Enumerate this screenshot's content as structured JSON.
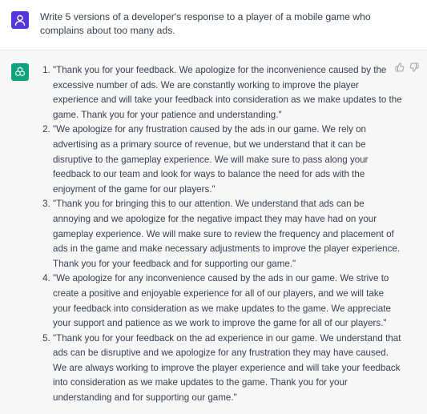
{
  "user": {
    "avatar_icon": "user-icon",
    "prompt": "Write 5 versions of a developer's response to a player of a mobile game who complains about too many ads."
  },
  "assistant": {
    "avatar_icon": "openai-logo-icon",
    "colors": {
      "user_avatar": "#5436da",
      "bot_avatar": "#10a37f"
    },
    "responses": [
      "\"Thank you for your feedback. We apologize for the inconvenience caused by the excessive number of ads. We are constantly working to improve the player experience and will take your feedback into consideration as we make updates to the game. Thank you for your patience and understanding.\"",
      "\"We apologize for any frustration caused by the ads in our game. We rely on advertising as a primary source of revenue, but we understand that it can be disruptive to the gameplay experience. We will make sure to pass along your feedback to our team and look for ways to balance the need for ads with the enjoyment of the game for our players.\"",
      "\"Thank you for bringing this to our attention. We understand that ads can be annoying and we apologize for the negative impact they may have had on your gameplay experience. We will make sure to review the frequency and placement of ads in the game and make necessary adjustments to improve the player experience. Thank you for your feedback and for supporting our game.\"",
      "\"We apologize for any inconvenience caused by the ads in our game. We strive to create a positive and enjoyable experience for all of our players, and we will take your feedback into consideration as we make updates to the game. We appreciate your support and patience as we work to improve the game for all of our players.\"",
      "\"Thank you for your feedback on the ad experience in our game. We understand that ads can be disruptive and we apologize for any frustration they may have caused. We are always working to improve the player experience and will take your feedback into consideration as we make updates to the game. Thank you for your understanding and for supporting our game.\""
    ],
    "feedback_icons": [
      "thumbs-up-icon",
      "thumbs-down-icon"
    ]
  }
}
